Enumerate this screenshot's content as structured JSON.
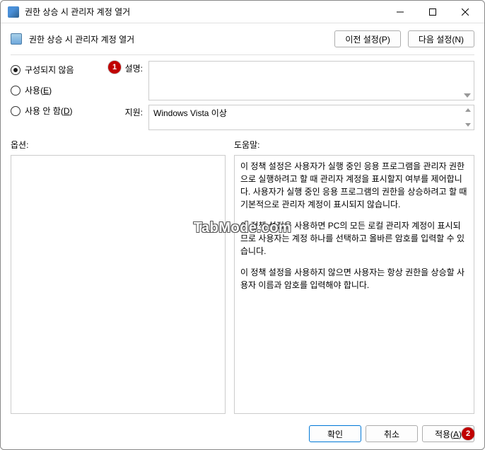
{
  "titlebar": {
    "title": "권한 상승 시 관리자 계정 열거"
  },
  "header": {
    "title": "권한 상승 시 관리자 계정 열거",
    "prev_btn": "이전 설정(P)",
    "next_btn": "다음 설정(N)"
  },
  "radios": {
    "not_configured": "구성되지 않음",
    "enabled_pre": "사용(",
    "enabled_u": "E",
    "enabled_post": ")",
    "disabled_pre": "사용 안 함(",
    "disabled_u": "D",
    "disabled_post": ")"
  },
  "info": {
    "desc_label": "설명:",
    "support_label": "지원:",
    "support_value": "Windows Vista 이상"
  },
  "labels": {
    "options": "옵션:",
    "help": "도움말:"
  },
  "help": {
    "p1": "이 정책 설정은 사용자가 실행 중인 응용 프로그램을 관리자 권한으로 실행하려고 할 때 관리자 계정을 표시할지 여부를 제어합니다. 사용자가 실행 중인 응용 프로그램의 권한을 상승하려고 할 때 기본적으로 관리자 계정이 표시되지 않습니다.",
    "p2": "이 정책 설정을 사용하면 PC의 모든 로컬 관리자 계정이 표시되므로 사용자는 계정 하나를 선택하고 올바른 암호를 입력할 수 있습니다.",
    "p3": "이 정책 설정을 사용하지 않으면 사용자는 항상 권한을 상승할 사용자 이름과 암호를 입력해야 합니다."
  },
  "footer": {
    "ok": "확인",
    "cancel": "취소",
    "apply_pre": "적용(",
    "apply_u": "A",
    "apply_post": ")"
  },
  "callouts": {
    "c1": "1",
    "c2": "2"
  },
  "watermark": "TabMode.com"
}
